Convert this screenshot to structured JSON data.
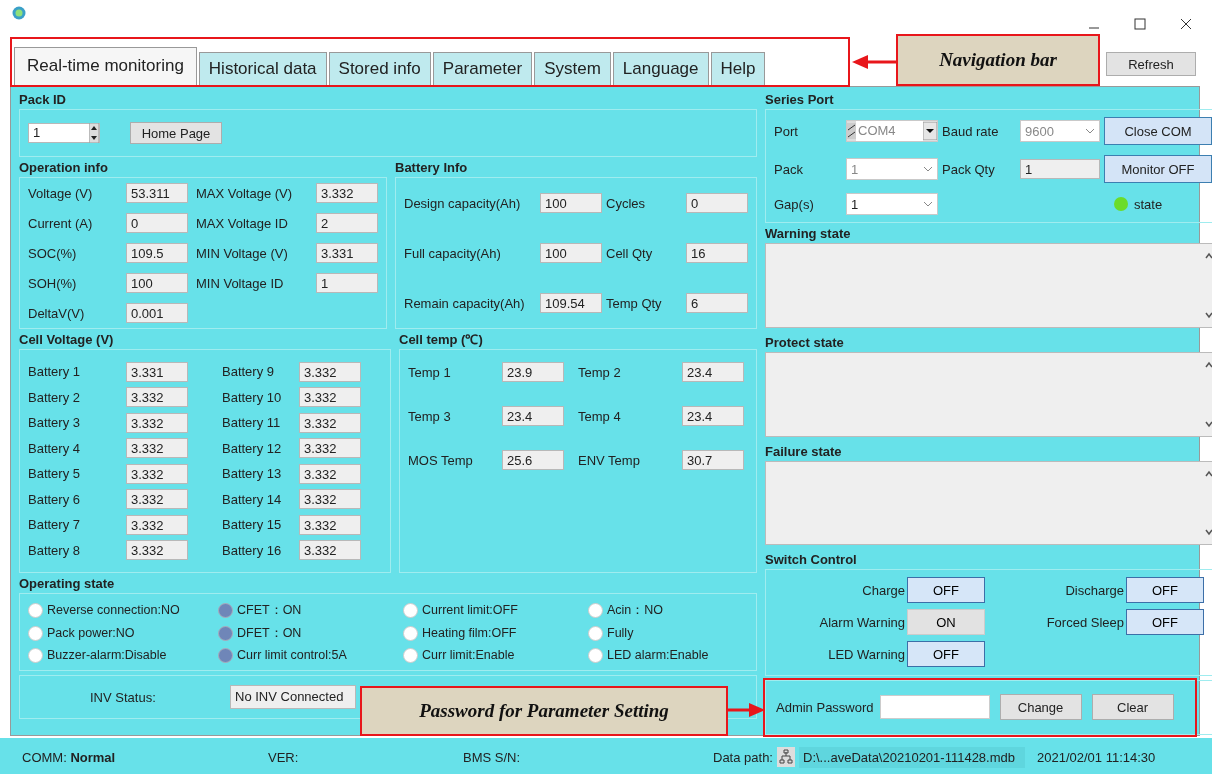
{
  "tabs": [
    {
      "label": "Real-time monitoring",
      "selected": true
    },
    {
      "label": "Historical data",
      "selected": false
    },
    {
      "label": "Stored info",
      "selected": false
    },
    {
      "label": "Parameter",
      "selected": false
    },
    {
      "label": "System",
      "selected": false
    },
    {
      "label": "Language",
      "selected": false
    },
    {
      "label": "Help",
      "selected": false
    }
  ],
  "refresh_button": "Refresh",
  "pack_id": {
    "title": "Pack ID",
    "value": "1",
    "home_button": "Home Page"
  },
  "operation_info": {
    "title": "Operation info",
    "fields": [
      {
        "label": "Voltage (V)",
        "value": "53.311"
      },
      {
        "label": "MAX Voltage (V)",
        "value": "3.332"
      },
      {
        "label": "Current (A)",
        "value": "0"
      },
      {
        "label": "MAX Voltage ID",
        "value": "2"
      },
      {
        "label": "SOC(%)",
        "value": "109.5"
      },
      {
        "label": "MIN Voltage (V)",
        "value": "3.331"
      },
      {
        "label": "SOH(%)",
        "value": "100"
      },
      {
        "label": "MIN Voltage ID",
        "value": "1"
      },
      {
        "label": "DeltaV(V)",
        "value": "0.001"
      }
    ]
  },
  "battery_info": {
    "title": "Battery Info",
    "fields": [
      {
        "label": "Design capacity(Ah)",
        "value": "100"
      },
      {
        "label": "Cycles",
        "value": "0"
      },
      {
        "label": "Full capacity(Ah)",
        "value": "100"
      },
      {
        "label": "Cell Qty",
        "value": "16"
      },
      {
        "label": "Remain capacity(Ah)",
        "value": "109.54"
      },
      {
        "label": "Temp Qty",
        "value": "6"
      }
    ]
  },
  "cell_voltage": {
    "title": "Cell Voltage (V)",
    "cells": [
      {
        "label": "Battery 1",
        "value": "3.331"
      },
      {
        "label": "Battery 2",
        "value": "3.332"
      },
      {
        "label": "Battery 3",
        "value": "3.332"
      },
      {
        "label": "Battery 4",
        "value": "3.332"
      },
      {
        "label": "Battery 5",
        "value": "3.332"
      },
      {
        "label": "Battery 6",
        "value": "3.332"
      },
      {
        "label": "Battery 7",
        "value": "3.332"
      },
      {
        "label": "Battery 8",
        "value": "3.332"
      },
      {
        "label": "Battery 9",
        "value": "3.332"
      },
      {
        "label": "Battery 10",
        "value": "3.332"
      },
      {
        "label": "Battery 11",
        "value": "3.332"
      },
      {
        "label": "Battery 12",
        "value": "3.332"
      },
      {
        "label": "Battery 13",
        "value": "3.332"
      },
      {
        "label": "Battery 14",
        "value": "3.332"
      },
      {
        "label": "Battery 15",
        "value": "3.332"
      },
      {
        "label": "Battery 16",
        "value": "3.332"
      }
    ]
  },
  "cell_temp": {
    "title": "Cell temp (℃)",
    "fields": [
      {
        "label": "Temp 1",
        "value": "23.9"
      },
      {
        "label": "Temp 2",
        "value": "23.4"
      },
      {
        "label": "Temp 3",
        "value": "23.4"
      },
      {
        "label": "Temp 4",
        "value": "23.4"
      },
      {
        "label": "MOS Temp",
        "value": "25.6"
      },
      {
        "label": "ENV Temp",
        "value": "30.7"
      }
    ]
  },
  "operating_state": {
    "title": "Operating state",
    "items": [
      {
        "label": "Reverse connection:NO",
        "on": false
      },
      {
        "label": "CFET：ON",
        "on": true
      },
      {
        "label": "Current limit:OFF",
        "on": false
      },
      {
        "label": "Acin：NO",
        "on": false
      },
      {
        "label": "Pack power:NO",
        "on": false
      },
      {
        "label": "DFET：ON",
        "on": true
      },
      {
        "label": "Heating film:OFF",
        "on": false
      },
      {
        "label": "Fully",
        "on": false
      },
      {
        "label": "Buzzer-alarm:Disable",
        "on": false
      },
      {
        "label": "Curr limit control:5A",
        "on": true
      },
      {
        "label": "Curr limit:Enable",
        "on": false
      },
      {
        "label": "LED alarm:Enable",
        "on": false
      }
    ]
  },
  "inv_status": {
    "label": "INV Status:",
    "value": "No INV Connected"
  },
  "series_port": {
    "title": "Series Port",
    "port_label": "Port",
    "port_value": "COM4",
    "baud_label": "Baud rate",
    "baud_value": "9600",
    "pack_label": "Pack",
    "pack_value": "1",
    "qty_label": "Pack Qty",
    "qty_value": "1",
    "gap_label": "Gap(s)",
    "gap_value": "1",
    "close_button": "Close COM",
    "monitor_button": "Monitor OFF",
    "state_label": "state",
    "state_on": true
  },
  "state_boxes": [
    {
      "title": "Warning state"
    },
    {
      "title": "Protect state"
    },
    {
      "title": "Failure state"
    }
  ],
  "switch_control": {
    "title": "Switch Control",
    "items": [
      {
        "label": "Charge",
        "value": "OFF",
        "on": false
      },
      {
        "label": "Discharge",
        "value": "OFF",
        "on": false
      },
      {
        "label": "Alarm Warning",
        "value": "ON",
        "on": true
      },
      {
        "label": "Forced Sleep",
        "value": "OFF",
        "on": false
      },
      {
        "label": "LED Warning",
        "value": "OFF",
        "on": false
      }
    ]
  },
  "admin": {
    "label": "Admin Password",
    "change_button": "Change",
    "clear_button": "Clear"
  },
  "status_bar": {
    "comm_label": "COMM:",
    "comm_value": "Normal",
    "ver_label": "VER:",
    "sn_label": "BMS S/N:",
    "path_label": "Data path:",
    "path_value": "D:\\...aveData\\20210201-111428.mdb",
    "datetime": "2021/02/01 11:14:30"
  },
  "annotations": [
    {
      "text": "Navigation bar"
    },
    {
      "text": "Password for Parameter Setting"
    }
  ]
}
